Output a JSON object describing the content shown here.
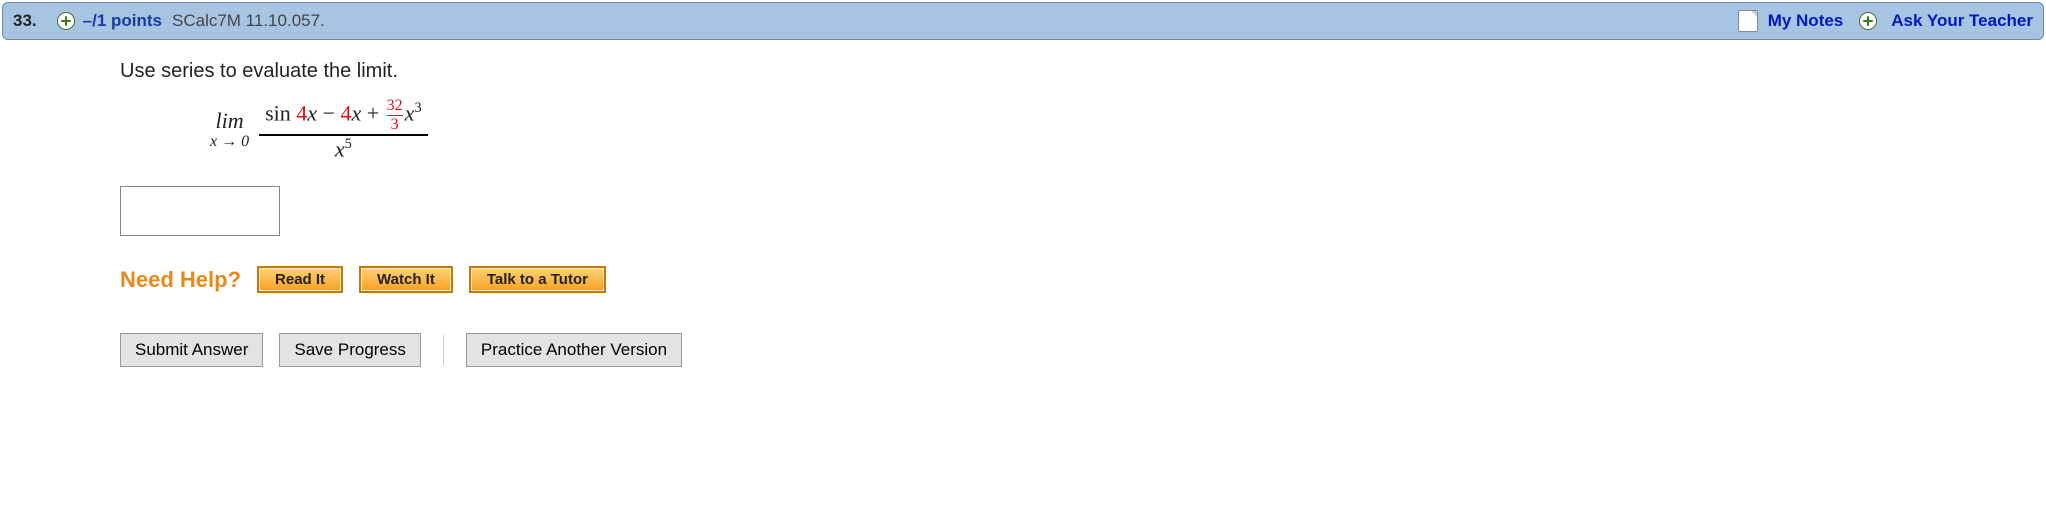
{
  "header": {
    "question_number": "33.",
    "points_text": "–/1 points",
    "source_code": "SCalc7M 11.10.057.",
    "my_notes_label": "My Notes",
    "ask_teacher_label": "Ask Your Teacher"
  },
  "prompt": "Use series to evaluate the limit.",
  "math": {
    "lim_label": "lim",
    "lim_sub": "x → 0",
    "top_sin": "sin ",
    "coeff_a": "4",
    "var": "x",
    "minus": " − ",
    "coeff_b": "4",
    "plus": " + ",
    "frac_top": "32",
    "frac_bot": "3",
    "exp1": "3",
    "denom_var": "x",
    "denom_exp": "5"
  },
  "help": {
    "need_help_label": "Need Help?",
    "read_it": "Read It",
    "watch_it": "Watch It",
    "talk_tutor": "Talk to a Tutor"
  },
  "buttons": {
    "submit": "Submit Answer",
    "save": "Save Progress",
    "practice": "Practice Another Version"
  }
}
